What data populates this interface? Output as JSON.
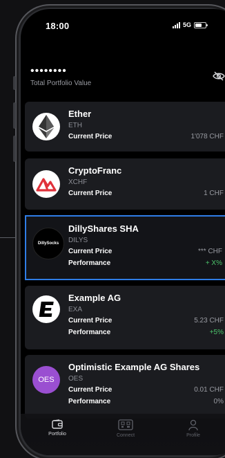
{
  "status_bar": {
    "time": "18:00",
    "network": "5G"
  },
  "portfolio": {
    "total_value_masked": "••••••••",
    "total_label": "Total Portfolio Value",
    "visibility_icon": "eye-off-icon"
  },
  "assets": [
    {
      "name": "Ether",
      "symbol": "ETH",
      "logo_icon": "ethereum-icon",
      "current_price_label": "Current Price",
      "current_price": "1'078 CHF"
    },
    {
      "name": "CryptoFranc",
      "symbol": "XCHF",
      "logo_icon": "cryptofranc-icon",
      "current_price_label": "Current Price",
      "current_price": "1 CHF"
    },
    {
      "name": "DillyShares SHA",
      "symbol": "DILYS",
      "logo_text": "DillySocks",
      "current_price_label": "Current Price",
      "current_price": "*** CHF",
      "performance_label": "Performance",
      "performance": "+ X%"
    },
    {
      "name": "Example AG",
      "symbol": "EXA",
      "logo_icon": "example-ag-icon",
      "current_price_label": "Current Price",
      "current_price": "5.23 CHF",
      "performance_label": "Performance",
      "performance": "+5%"
    },
    {
      "name": "Optimistic Example AG Shares",
      "symbol": "OES",
      "logo_text": "OES",
      "current_price_label": "Current Price",
      "current_price": "0.01 CHF",
      "performance_label": "Performance",
      "performance": "0%"
    }
  ],
  "nav": [
    {
      "label": "Portfolio",
      "icon": "wallet-icon",
      "active": true
    },
    {
      "label": "Connect",
      "icon": "qr-scan-icon",
      "active": false
    },
    {
      "label": "Profile",
      "icon": "person-icon",
      "active": false
    }
  ],
  "colors": {
    "selection_border": "#2f7de6",
    "positive": "#4cc46b",
    "card_bg": "#1b1c20",
    "oes_logo": "#9a4fd1",
    "cryptofranc_red": "#e0323b"
  }
}
